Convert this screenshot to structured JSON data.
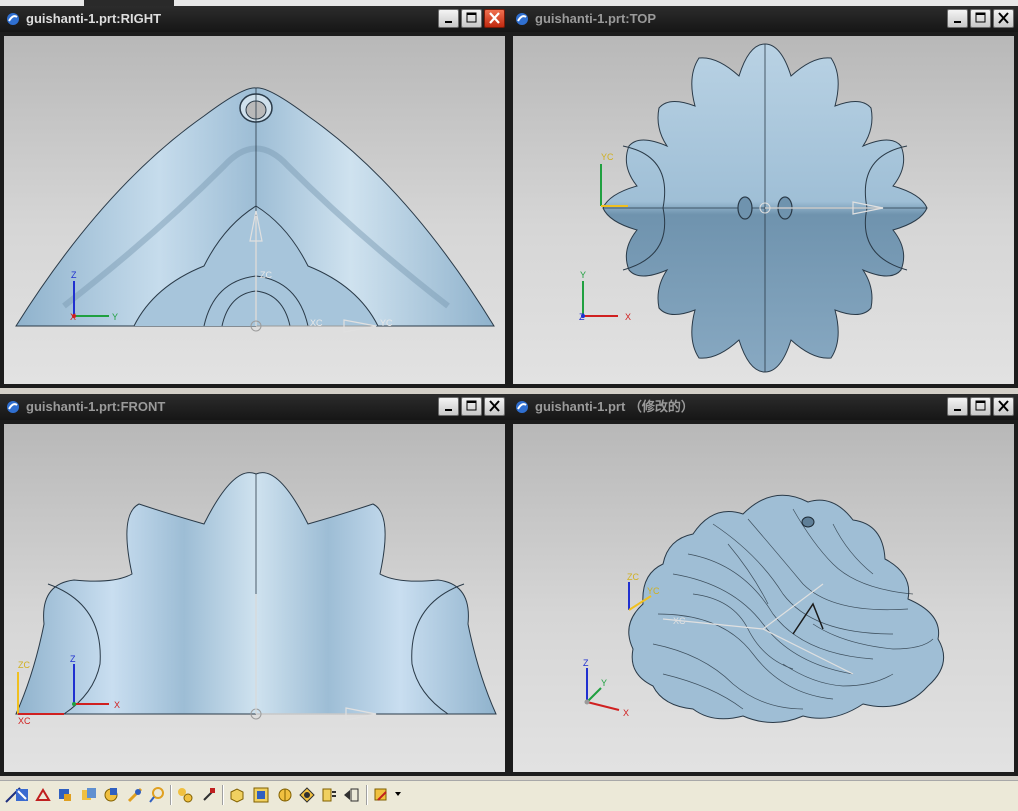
{
  "viewports": [
    {
      "id": "right",
      "title": "guishanti-1.prt:RIGHT",
      "active": true
    },
    {
      "id": "top",
      "title": "guishanti-1.prt:TOP",
      "active": false
    },
    {
      "id": "front",
      "title": "guishanti-1.prt:FRONT",
      "active": false
    },
    {
      "id": "iso",
      "title": "guishanti-1.prt （修改的）",
      "active": false
    }
  ],
  "axis_labels": {
    "right_triad": {
      "z": "Z",
      "x": "X",
      "y": "Y"
    },
    "right_wcs": {
      "zc": "ZC",
      "xc": "XC",
      "yc": "YC"
    },
    "top_triad": {
      "y": "Y",
      "z": "Z",
      "x": "X"
    },
    "top_wcs": {
      "yc": "YC"
    },
    "front_triad": {
      "zc": "ZC",
      "z": "Z",
      "x": "X",
      "xc": "XC"
    },
    "iso_triad": {
      "z": "Z",
      "y": "Y",
      "x": "X"
    },
    "iso_wcs": {
      "zc": "ZC",
      "yc": "YC",
      "xc": "XC"
    }
  },
  "colors": {
    "surface": "#a9c6dd",
    "surface_dark": "#6f93ae",
    "surface_light": "#d8e8f3",
    "axis_x": "#d02020",
    "axis_y": "#20a040",
    "axis_z": "#2030d0",
    "wcs": "#f0c020"
  },
  "toolbar": {
    "icons": [
      "snap-icon",
      "select-icon",
      "transform-icon",
      "move-icon",
      "copy-icon",
      "rotate-icon",
      "measure-icon",
      "analysis-icon",
      "layer-icon",
      "view-icon",
      "render-icon",
      "shade-icon",
      "wireframe-icon",
      "edge-icon",
      "section-icon",
      "display-icon"
    ]
  }
}
